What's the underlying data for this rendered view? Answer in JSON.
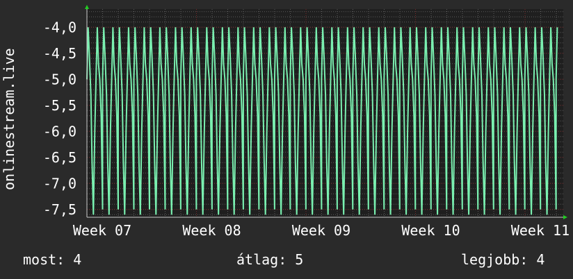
{
  "chart_data": {
    "type": "line",
    "ylabel": "onlinestream.live",
    "yticks": [
      -4.0,
      -4.5,
      -5.0,
      -5.5,
      -6.0,
      -6.5,
      -7.0,
      -7.5
    ],
    "ytick_labels": [
      "-4,0",
      "-4,5",
      "-5,0",
      "-5,5",
      "-6,0",
      "-6,5",
      "-7,0",
      "-7,5"
    ],
    "ylim": [
      -7.65,
      -3.65
    ],
    "xticks": [
      "Week 07",
      "Week 08",
      "Week 09",
      "Week 10",
      "Week 11"
    ],
    "xlim": [
      0,
      4.3
    ],
    "grid": true,
    "colors": {
      "line": "#7af0b0",
      "grid_major": "#7a2a2a",
      "grid_minor": "#5a5a5a",
      "axis_arrow": "#22cc22",
      "background": "#2a2a2a",
      "plot_bg": "#1f1f1f"
    },
    "pattern": {
      "x": [
        0.0,
        0.012,
        0.024,
        0.04,
        0.052,
        0.065,
        0.079,
        0.09,
        0.104,
        0.116,
        0.129,
        0.143,
        0.157
      ],
      "y": [
        -5.0,
        -4.0,
        -4.5,
        -5.3,
        -6.6,
        -7.6,
        -6.0,
        -5.1,
        -4.0,
        -4.7,
        -5.0,
        -5.7,
        -7.5
      ]
    },
    "period_per_week": 0.1428
  },
  "stats": {
    "now": "most: 4",
    "avg": "átlag: 5",
    "best": "legjobb: 4"
  }
}
